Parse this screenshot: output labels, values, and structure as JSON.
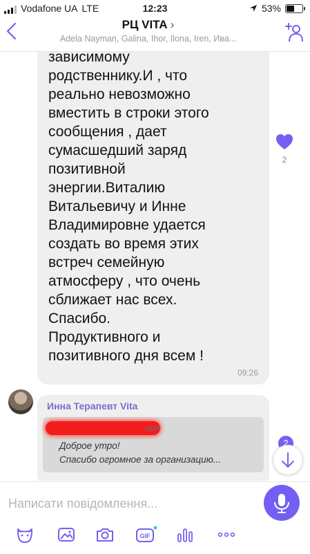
{
  "status_bar": {
    "carrier": "Vodafone UA",
    "network": "LTE",
    "time": "12:23",
    "battery": "53%",
    "battery_fraction": 0.53
  },
  "header": {
    "title": "РЦ VITA",
    "title_chevron": "›",
    "members": "Adela Nayman, Galina, Ihor, Ilona, Iren, Ива..."
  },
  "messages": {
    "first": {
      "text": "зависимому\nродственнику.И , что\nреально невозможно\nвместить в строки этого\nсообщения , дает\nсумасшедший заряд\nпозитивной\nэнергии.Виталию\nВитальевичу и Инне\nВладимировне удается\nсоздать во время этих\nвстреч семейную\nатмосферу , что очень\nсближает нас всех.\nСпасибо.\nПродуктивного и\nпозитивного дня всем !",
      "time": "09:26",
      "likes": "2"
    },
    "second": {
      "sender": "Инна Терапевт Vita",
      "quote_tail": "ния",
      "quote_lines": [
        "Доброе утро!",
        "Спасибо огромное за организацию..."
      ]
    },
    "unread_count": "2"
  },
  "composer": {
    "placeholder": "Написати повідомлення..."
  },
  "colors": {
    "accent": "#7360f2",
    "sender": "#7f6cc8",
    "bubble": "#efefef"
  }
}
